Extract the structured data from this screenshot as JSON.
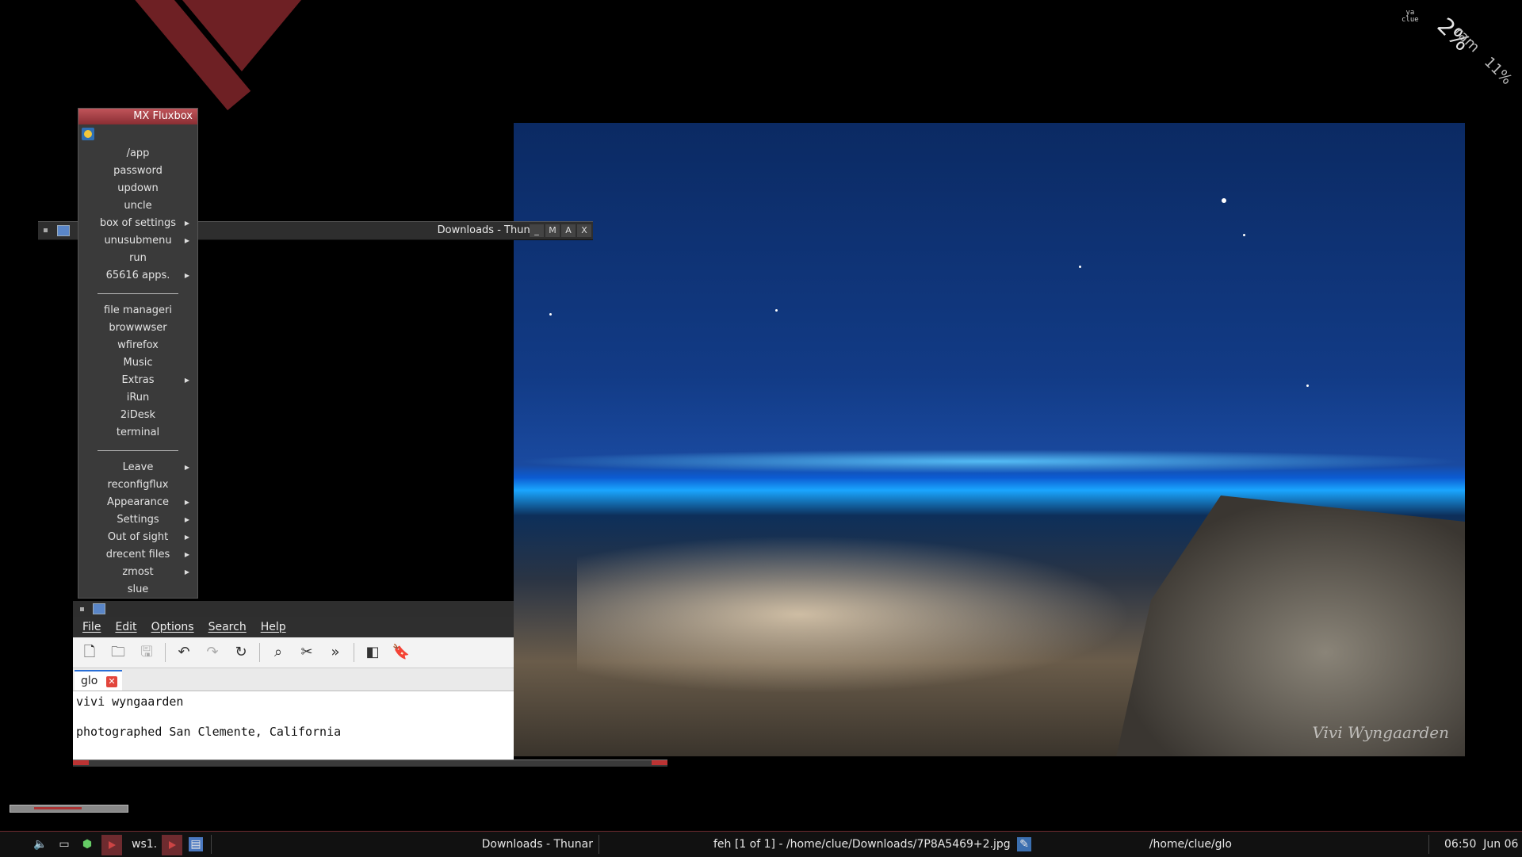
{
  "conky": {
    "user_line1": "ya",
    "user_line2": "clue",
    "cpu": "2%",
    "ram_label": "ram",
    "ram": "11%"
  },
  "menu": {
    "title": "MX Fluxbox",
    "items": [
      {
        "label": "/app",
        "sub": false
      },
      {
        "label": "password",
        "sub": false
      },
      {
        "label": "updown",
        "sub": false
      },
      {
        "label": "uncle",
        "sub": false
      },
      {
        "label": "box of settings",
        "sub": true
      },
      {
        "label": "unusubmenu",
        "sub": true
      },
      {
        "label": "run",
        "sub": false
      },
      {
        "label": "65616 apps.",
        "sub": true
      },
      {
        "label": "",
        "sep": true
      },
      {
        "label": "file manageri",
        "sub": false
      },
      {
        "label": "browwwser",
        "sub": false
      },
      {
        "label": "wfirefox",
        "sub": false
      },
      {
        "label": "Music",
        "sub": false
      },
      {
        "label": "Extras",
        "sub": true
      },
      {
        "label": "iRun",
        "sub": false
      },
      {
        "label": "2iDesk",
        "sub": false
      },
      {
        "label": "terminal",
        "sub": false
      },
      {
        "label": "",
        "sep": true
      },
      {
        "label": "Leave",
        "sub": true
      },
      {
        "label": "reconfigflux",
        "sub": false
      },
      {
        "label": "Appearance",
        "sub": true
      },
      {
        "label": "Settings",
        "sub": true
      },
      {
        "label": "Out of sight",
        "sub": true
      },
      {
        "label": "drecent files",
        "sub": true
      },
      {
        "label": "zmost",
        "sub": true
      },
      {
        "label": "slue",
        "sub": false
      }
    ]
  },
  "thunar": {
    "title": "Downloads - Thunar",
    "buttons": [
      "_",
      "M",
      "A",
      "X"
    ]
  },
  "editor": {
    "menu": [
      "File",
      "Edit",
      "Options",
      "Search",
      "Help"
    ],
    "toolbar": [
      {
        "icon": "new-file-icon",
        "glyph": "🗋",
        "disabled": false
      },
      {
        "icon": "open-folder-icon",
        "glyph": "🗀",
        "disabled": false
      },
      {
        "icon": "save-icon",
        "glyph": "🖫",
        "disabled": true
      },
      {
        "sep": true
      },
      {
        "icon": "undo-icon",
        "glyph": "↶",
        "disabled": false
      },
      {
        "icon": "redo-icon",
        "glyph": "↷",
        "disabled": true
      },
      {
        "icon": "reload-icon",
        "glyph": "↻",
        "disabled": false
      },
      {
        "sep": true
      },
      {
        "icon": "search-icon",
        "glyph": "⌕",
        "disabled": false
      },
      {
        "icon": "replace-icon",
        "glyph": "✂",
        "disabled": false
      },
      {
        "icon": "jump-icon",
        "glyph": "»",
        "disabled": false
      },
      {
        "sep": true
      },
      {
        "icon": "side-pane-icon",
        "glyph": "◧",
        "disabled": false
      },
      {
        "icon": "bookmark-icon",
        "glyph": "🔖",
        "disabled": false
      }
    ],
    "tab": "glo",
    "lines": [
      "vivi wyngaarden",
      "",
      "photographed San Clemente, California"
    ]
  },
  "photo": {
    "signature": "Vivi Wyngaarden"
  },
  "taskbar": {
    "workspace": "ws1.",
    "task1": "Downloads - Thunar",
    "task2": "feh [1 of 1] - /home/clue/Downloads/7P8A5469+2.jpg",
    "task3": "/home/clue/glo",
    "clock": "06:50  Jun 06"
  }
}
